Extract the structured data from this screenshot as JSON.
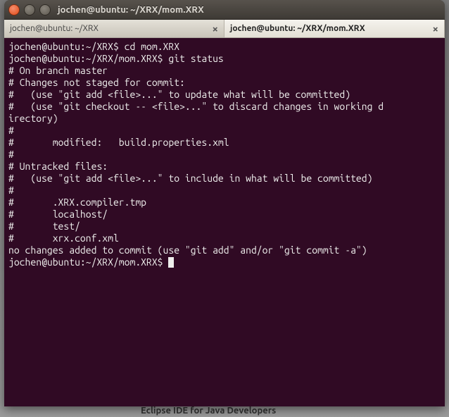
{
  "window": {
    "title": "jochen@ubuntu: ~/XRX/mom.XRX"
  },
  "tabs": [
    {
      "label": "jochen@ubuntu: ~/XRX",
      "active": false
    },
    {
      "label": "jochen@ubuntu: ~/XRX/mom.XRX",
      "active": true
    }
  ],
  "terminal": {
    "prompt1": "jochen@ubuntu:~/XRX$",
    "cmd1": "cd mom.XRX",
    "prompt2": "jochen@ubuntu:~/XRX/mom.XRX$",
    "cmd2": "git status",
    "out": [
      "# On branch master",
      "# Changes not staged for commit:",
      "#   (use \"git add <file>...\" to update what will be committed)",
      "#   (use \"git checkout -- <file>...\" to discard changes in working d",
      "irectory)",
      "#",
      "#       modified:   build.properties.xml",
      "#",
      "# Untracked files:",
      "#   (use \"git add <file>...\" to include in what will be committed)",
      "#",
      "#       .XRX.compiler.tmp",
      "#       localhost/",
      "#       test/",
      "#       xrx.conf.xml",
      "no changes added to commit (use \"git add\" and/or \"git commit -a\")"
    ],
    "prompt3": "jochen@ubuntu:~/XRX/mom.XRX$"
  },
  "background": {
    "peek_text": "Eclipse IDE for Java Developers"
  }
}
